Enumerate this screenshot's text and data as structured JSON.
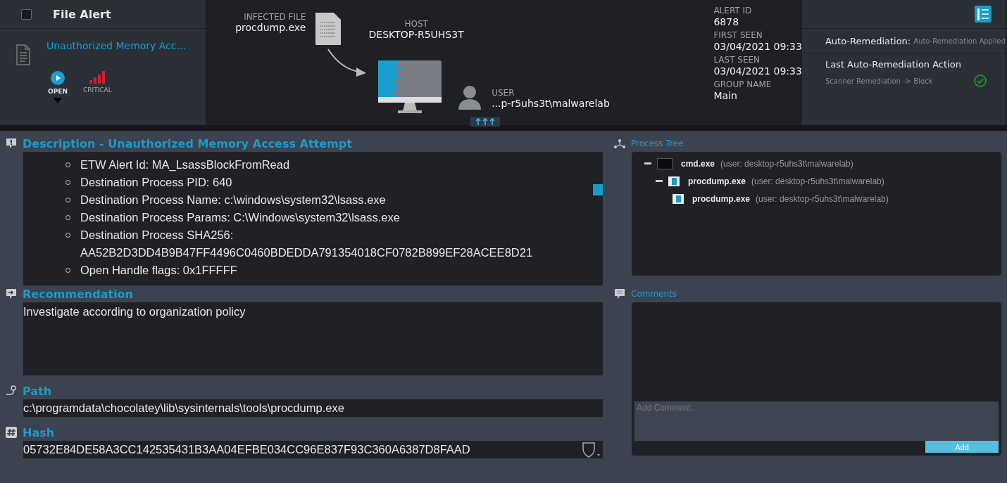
{
  "header": {
    "checked": false,
    "title": "File Alert",
    "alert_name": "Unauthorized Memory Acc...",
    "status": "OPEN",
    "severity": "CRITICAL",
    "infected_file": {
      "label": "INFECTED FILE",
      "value": "procdump.exe"
    },
    "host": {
      "label": "HOST",
      "value": "DESKTOP-R5UHS3T"
    },
    "user": {
      "label": "USER",
      "value": "...p-r5uhs3t\\malwarelab"
    },
    "meta": [
      {
        "label": "ALERT ID",
        "value": "6878"
      },
      {
        "label": "FIRST SEEN",
        "value": "03/04/2021 09:33"
      },
      {
        "label": "LAST SEEN",
        "value": "03/04/2021 09:33"
      },
      {
        "label": "GROUP NAME",
        "value": "Main"
      }
    ],
    "auto_remediation": {
      "label": "Auto-Remediation:",
      "value": "Auto-Remediation Applied"
    },
    "last_action": {
      "label": "Last Auto-Remediation Action",
      "value": "Scanner Remediation -> Block"
    }
  },
  "description": {
    "title": "Description - Unauthorized Memory Access Attempt",
    "items": [
      "ETW Alert Id: MA_LsassBlockFromRead",
      "Destination Process PID: 640",
      "Destination Process Name: c:\\windows\\system32\\lsass.exe",
      "Destination Process Params: C:\\Windows\\system32\\lsass.exe",
      "Destination Process SHA256: AA52B2D3DD4B9B47FF4496C0460BDEDDA791354018CF0782B899EF28ACEE8D21",
      "Open Handle flags: 0x1FFFFF"
    ]
  },
  "recommendation": {
    "title": "Recommendation",
    "text": "Investigate according to organization policy"
  },
  "path": {
    "title": "Path",
    "value": "c:\\programdata\\chocolatey\\lib\\sysinternals\\tools\\procdump.exe"
  },
  "hash": {
    "title": "Hash",
    "value": "05732E84DE58A3CC142535431B3AA04EFBE034CC96E837F93C360A6387D8FAAD"
  },
  "process_tree": {
    "title": "Process Tree",
    "nodes": [
      {
        "name": "cmd.exe",
        "user": "(user: desktop-r5uhs3t\\malwarelab)",
        "kind": "terminal",
        "expanded": true,
        "children": [
          {
            "name": "procdump.exe",
            "user": "(user: desktop-r5uhs3t\\malwarelab)",
            "kind": "app",
            "expanded": true,
            "children": [
              {
                "name": "procdump.exe",
                "user": "(user: desktop-r5uhs3t\\malwarelab)",
                "kind": "app"
              }
            ]
          }
        ]
      }
    ]
  },
  "comments": {
    "title": "Comments",
    "placeholder": "Add Comment..",
    "button": "Add"
  }
}
